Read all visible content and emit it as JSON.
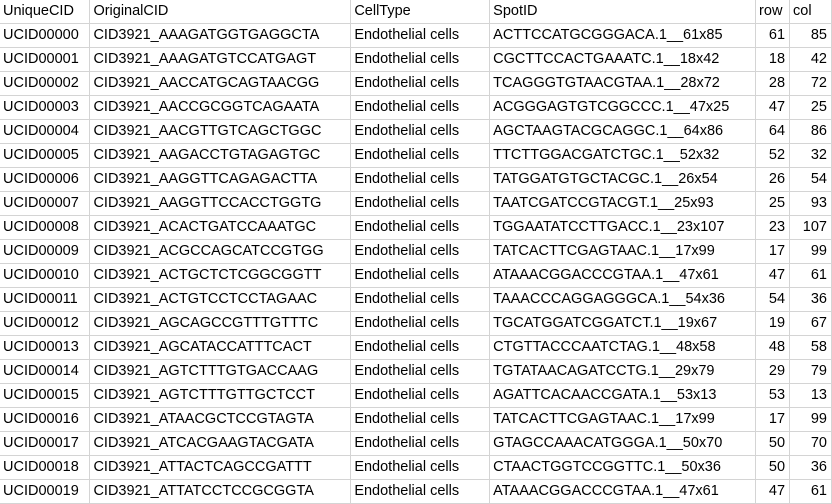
{
  "header": [
    "UniqueCID",
    "OriginalCID",
    "CellType",
    "SpotID",
    "row",
    "col"
  ],
  "rows": [
    [
      "UCID00000",
      "CID3921_AAAGATGGTGAGGCTA",
      "Endothelial cells",
      "ACTTCCATGCGGGACA.1__61x85",
      "61",
      "85"
    ],
    [
      "UCID00001",
      "CID3921_AAAGATGTCCATGAGT",
      "Endothelial cells",
      "CGCTTCCACTGAAATC.1__18x42",
      "18",
      "42"
    ],
    [
      "UCID00002",
      "CID3921_AACCATGCAGTAACGG",
      "Endothelial cells",
      "TCAGGGTGTAACGTAA.1__28x72",
      "28",
      "72"
    ],
    [
      "UCID00003",
      "CID3921_AACCGCGGTCAGAATA",
      "Endothelial cells",
      "ACGGGAGTGTCGGCCC.1__47x25",
      "47",
      "25"
    ],
    [
      "UCID00004",
      "CID3921_AACGTTGTCAGCTGGC",
      "Endothelial cells",
      "AGCTAAGTACGCAGGC.1__64x86",
      "64",
      "86"
    ],
    [
      "UCID00005",
      "CID3921_AAGACCTGTAGAGTGC",
      "Endothelial cells",
      "TTCTTGGACGATCTGC.1__52x32",
      "52",
      "32"
    ],
    [
      "UCID00006",
      "CID3921_AAGGTTCAGAGACTTA",
      "Endothelial cells",
      "TATGGATGTGCTACGC.1__26x54",
      "26",
      "54"
    ],
    [
      "UCID00007",
      "CID3921_AAGGTTCCACCTGGTG",
      "Endothelial cells",
      "TAATCGATCCGTACGT.1__25x93",
      "25",
      "93"
    ],
    [
      "UCID00008",
      "CID3921_ACACTGATCCAAATGC",
      "Endothelial cells",
      "TGGAATATCCTTGACC.1__23x107",
      "23",
      "107"
    ],
    [
      "UCID00009",
      "CID3921_ACGCCAGCATCCGTGG",
      "Endothelial cells",
      "TATCACTTCGAGTAAC.1__17x99",
      "17",
      "99"
    ],
    [
      "UCID00010",
      "CID3921_ACTGCTCTCGGCGGTT",
      "Endothelial cells",
      "ATAAACGGACCCGTAA.1__47x61",
      "47",
      "61"
    ],
    [
      "UCID00011",
      "CID3921_ACTGTCCTCCTAGAAC",
      "Endothelial cells",
      "TAAACCCAGGAGGGCA.1__54x36",
      "54",
      "36"
    ],
    [
      "UCID00012",
      "CID3921_AGCAGCCGTTTGTTTC",
      "Endothelial cells",
      "TGCATGGATCGGATCT.1__19x67",
      "19",
      "67"
    ],
    [
      "UCID00013",
      "CID3921_AGCATACCATTTCACT",
      "Endothelial cells",
      "CTGTTACCCAATCTAG.1__48x58",
      "48",
      "58"
    ],
    [
      "UCID00014",
      "CID3921_AGTCTTTGTGACCAAG",
      "Endothelial cells",
      "TGTATAACAGATCCTG.1__29x79",
      "29",
      "79"
    ],
    [
      "UCID00015",
      "CID3921_AGTCTTTGTTGCTCCT",
      "Endothelial cells",
      "AGATTCACAACCGATA.1__53x13",
      "53",
      "13"
    ],
    [
      "UCID00016",
      "CID3921_ATAACGCTCCGTAGTA",
      "Endothelial cells",
      "TATCACTTCGAGTAAC.1__17x99",
      "17",
      "99"
    ],
    [
      "UCID00017",
      "CID3921_ATCACGAAGTACGATA",
      "Endothelial cells",
      "GTAGCCAAACATGGGA.1__50x70",
      "50",
      "70"
    ],
    [
      "UCID00018",
      "CID3921_ATTACTCAGCCGATTT",
      "Endothelial cells",
      "CTAACTGGTCCGGTTC.1__50x36",
      "50",
      "36"
    ],
    [
      "UCID00019",
      "CID3921_ATTATCCTCCGCGGTA",
      "Endothelial cells",
      "ATAAACGGACCCGTAA.1__47x61",
      "47",
      "61"
    ]
  ],
  "colors": {
    "grid": "#d4d4d4",
    "background": "#ffffff",
    "text": "#000000"
  }
}
